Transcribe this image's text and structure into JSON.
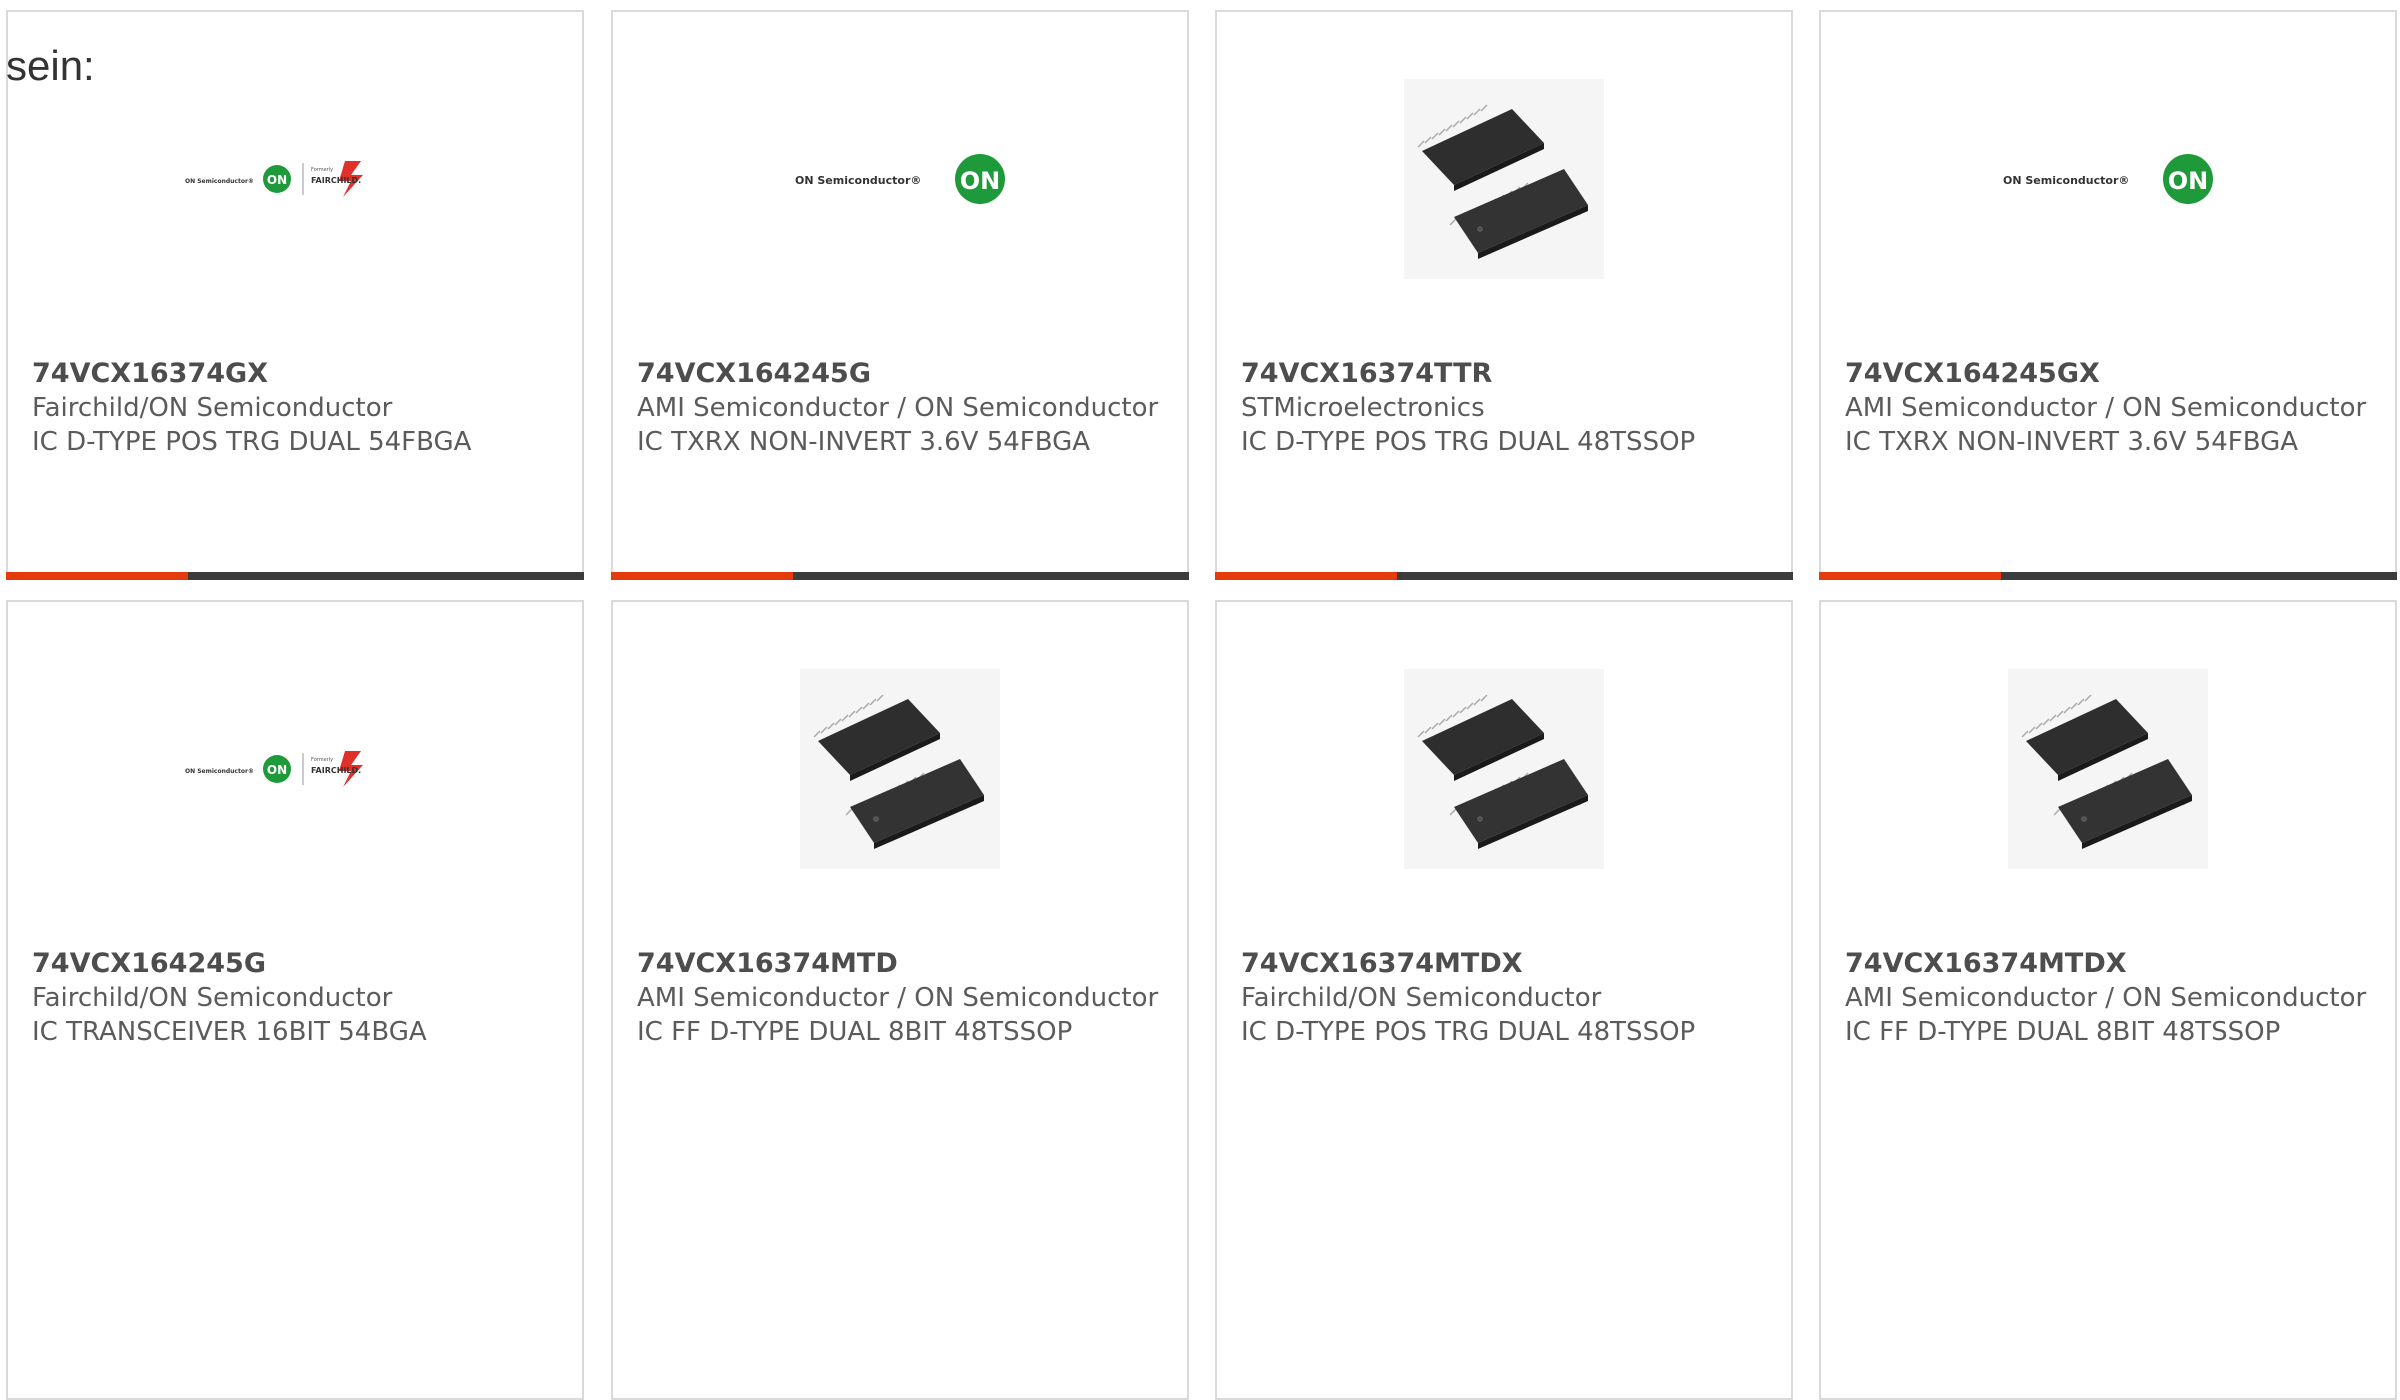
{
  "intro_text": "sein:",
  "colors": {
    "accent": "#e63b0c",
    "bar": "#3c3c3c",
    "on_green": "#1f9a3b",
    "fairchild_red": "#e0302a"
  },
  "cards": [
    {
      "part": "74VCX16374GX",
      "manufacturer": "Fairchild/ON Semiconductor",
      "description": "IC D-TYPE POS TRG DUAL 54FBGA",
      "image": "onsemi-fairchild-logo",
      "logo_left_text": "ON Semiconductor®",
      "logo_formerly": "Formerly",
      "logo_fairchild": "FAIRCHILD.",
      "logo_badge": "ON"
    },
    {
      "part": "74VCX164245G",
      "manufacturer": "AMI Semiconductor / ON Semiconductor",
      "description": "IC TXRX NON-INVERT 3.6V 54FBGA",
      "image": "onsemi-logo",
      "logo_left_text": "ON Semiconductor®",
      "logo_badge": "ON"
    },
    {
      "part": "74VCX16374TTR",
      "manufacturer": "STMicroelectronics",
      "description": "IC D-TYPE POS TRG DUAL 48TSSOP",
      "image": "tssop-chip-photo"
    },
    {
      "part": "74VCX164245GX",
      "manufacturer": "AMI Semiconductor / ON Semiconductor",
      "description": "IC TXRX NON-INVERT 3.6V 54FBGA",
      "image": "onsemi-logo",
      "logo_left_text": "ON Semiconductor®",
      "logo_badge": "ON"
    },
    {
      "part": "74VCX164245G",
      "manufacturer": "Fairchild/ON Semiconductor",
      "description": "IC TRANSCEIVER 16BIT 54BGA",
      "image": "onsemi-fairchild-logo",
      "logo_left_text": "ON Semiconductor®",
      "logo_formerly": "Formerly",
      "logo_fairchild": "FAIRCHILD.",
      "logo_badge": "ON"
    },
    {
      "part": "74VCX16374MTD",
      "manufacturer": "AMI Semiconductor / ON Semiconductor",
      "description": "IC FF D-TYPE DUAL 8BIT 48TSSOP",
      "image": "tssop-chip-photo"
    },
    {
      "part": "74VCX16374MTDX",
      "manufacturer": "Fairchild/ON Semiconductor",
      "description": "IC D-TYPE POS TRG DUAL 48TSSOP",
      "image": "tssop-chip-photo"
    },
    {
      "part": "74VCX16374MTDX",
      "manufacturer": "AMI Semiconductor / ON Semiconductor",
      "description": "IC FF D-TYPE DUAL 8BIT 48TSSOP",
      "image": "tssop-chip-photo"
    }
  ]
}
